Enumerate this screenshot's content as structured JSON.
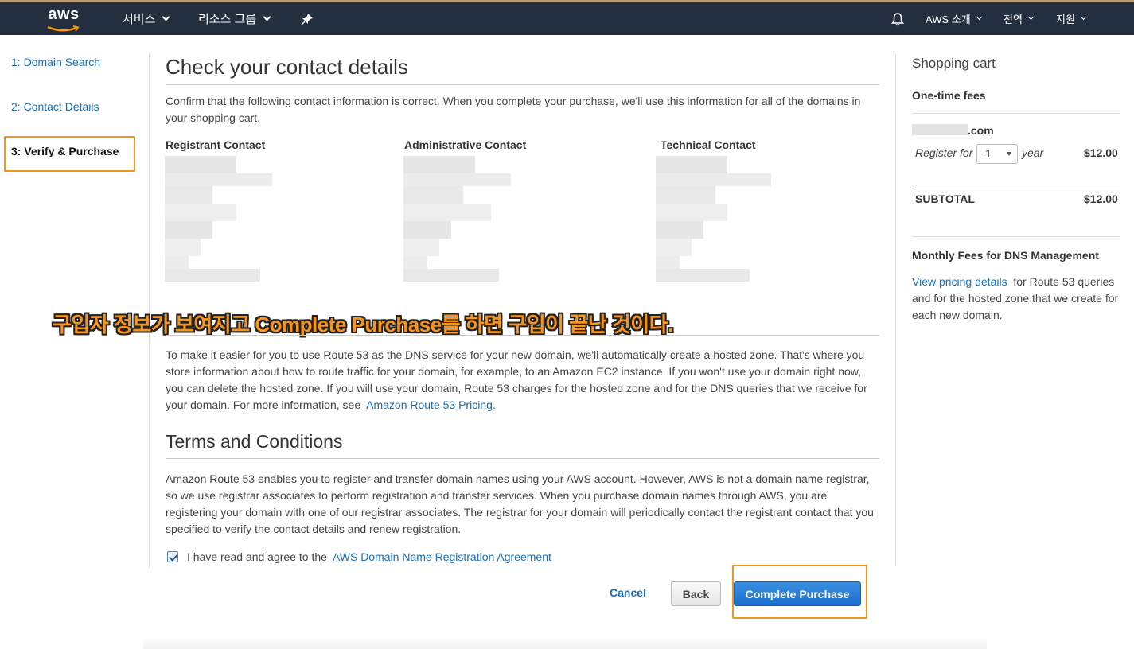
{
  "nav": {
    "logo": "aws",
    "services": "서비스",
    "resource_groups": "리소스 그룹",
    "aws_intro": "AWS 소개",
    "region": "전역",
    "support": "지원"
  },
  "steps": [
    {
      "label": "1: Domain Search"
    },
    {
      "label": "2: Contact Details"
    },
    {
      "label": "3: Verify & Purchase"
    }
  ],
  "main": {
    "title": "Check your contact details",
    "intro": "Confirm that the following contact information is correct. When you complete your purchase, we'll use this information for all of the domains in your shopping cart.",
    "contacts": [
      "Registrant Contact",
      "Administrative Contact",
      "Technical Contact"
    ],
    "hosted_zone_text": "To make it easier for you to use Route 53 as the DNS service for your new domain, we'll automatically create a hosted zone. That's where you store information about how to route traffic for your domain, for example, to an Amazon EC2 instance. If you won't use your domain right now, you can delete the hosted zone. If you will use your domain, Route 53 charges for the hosted zone and for the DNS queries that we receive for your domain. For more information, see",
    "pricing_link": "Amazon Route 53 Pricing.",
    "terms_title": "Terms and Conditions",
    "terms_text": "Amazon Route 53 enables you to register and transfer domain names using your AWS account. However, AWS is not a domain name registrar, so we use registrar associates to perform registration and transfer services. When you purchase domain names through AWS, you are registering your domain with one of our registrar associates. The registrar for your domain will periodically contact the registrant contact that you specified to verify the contact details and renew registration.",
    "agree_text": "I have read and agree to the",
    "agree_link": "AWS Domain Name Registration Agreement",
    "agree_checked": true
  },
  "overlay_caption": "구입자 정보가 보여지고 Complete Purchase를 하면 구입이 끝난 것이다.",
  "buttons": {
    "cancel": "Cancel",
    "back": "Back",
    "complete": "Complete Purchase"
  },
  "cart": {
    "title": "Shopping cart",
    "one_time_fees": "One-time fees",
    "domain_suffix": ".com",
    "register_for": "Register for",
    "years_value": "1",
    "year": "year",
    "price": "$12.00",
    "subtotal_label": "SUBTOTAL",
    "subtotal_value": "$12.00",
    "monthly_title": "Monthly Fees for DNS Management",
    "pricing_link": "View pricing details",
    "monthly_text": "for Route 53 queries and for the hosted zone that we create for each new domain."
  },
  "colors": {
    "navbar": "#232f3e",
    "link": "#1a6fb5",
    "highlight": "#f0951e",
    "primary_button": "#1b6fcf"
  }
}
